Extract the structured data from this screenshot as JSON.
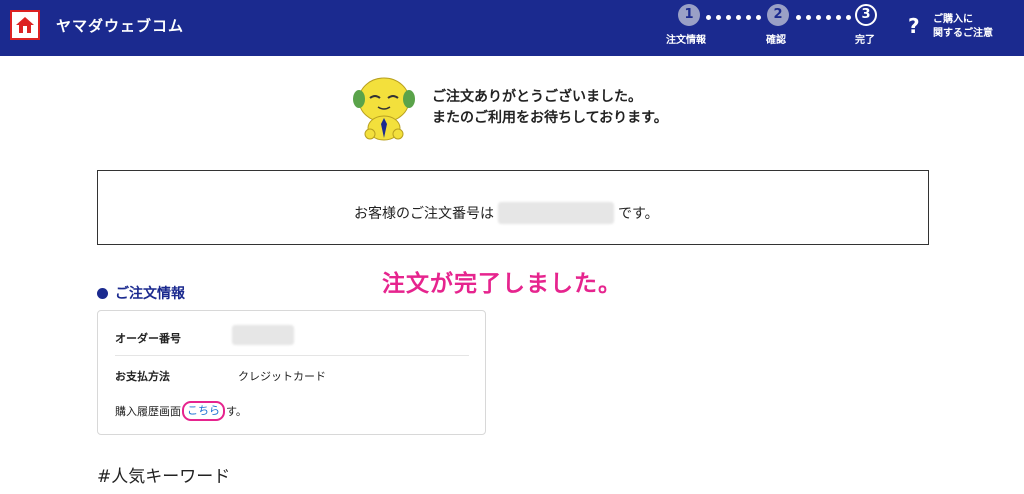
{
  "header": {
    "brand": "ヤマダウェブコム",
    "steps": [
      {
        "number": "1",
        "label": "注文情報",
        "state": "done"
      },
      {
        "number": "2",
        "label": "確認",
        "state": "done"
      },
      {
        "number": "3",
        "label": "完了",
        "state": "current"
      }
    ],
    "help": {
      "symbol": "?",
      "line1": "ご購入に",
      "line2": "関するご注意"
    }
  },
  "thanks": {
    "line1": "ご注文ありがとうございました。",
    "line2": "またのご利用をお待ちしております。"
  },
  "order_box": {
    "prefix": "お客様のご注文番号は",
    "suffix": "です。"
  },
  "annotation": "注文が完了しました。",
  "order_info": {
    "title": "ご注文情報",
    "order_number_label": "オーダー番号",
    "payment_label": "お支払方法",
    "payment_value": "クレジットカード",
    "history_prefix": "購入履歴画面",
    "history_link": "こちら",
    "history_suffix": "す。"
  },
  "keywords_heading": "#人気キーワード",
  "colors": {
    "header_bg": "#1b2a8f",
    "accent_pink": "#e6248e",
    "link_blue": "#1a6fd1"
  }
}
